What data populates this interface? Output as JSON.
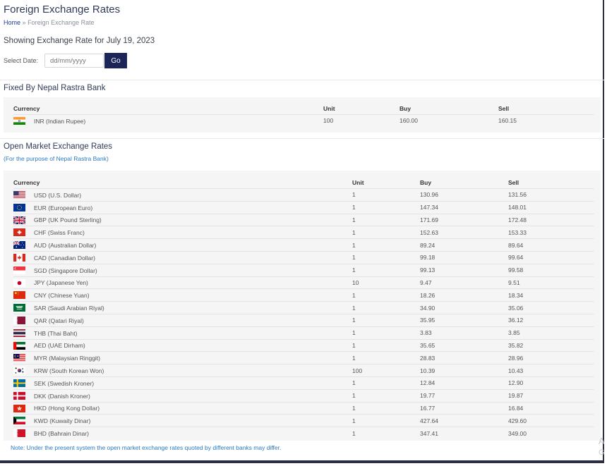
{
  "page": {
    "title": "Foreign Exchange Rates",
    "breadcrumb": {
      "home": "Home",
      "separator": "»",
      "current": "Foreign Exchange Rate"
    },
    "showing": "Showing Exchange Rate for July 19, 2023",
    "date_label": "Select Date:",
    "date_placeholder": "dd/mm/yyyy",
    "go_label": "Go"
  },
  "fixed": {
    "title": "Fixed By Nepal Rastra Bank",
    "headers": {
      "currency": "Currency",
      "unit": "Unit",
      "buy": "Buy",
      "sell": "Sell"
    },
    "rows": [
      {
        "flag": "india-flag-icon",
        "currency": "INR (Indian Rupee)",
        "unit": "100",
        "buy": "160.00",
        "sell": "160.15"
      }
    ]
  },
  "open_market": {
    "title": "Open Market Exchange Rates",
    "subtitle": "(For the purpose of Nepal Rastra Bank)",
    "headers": {
      "currency": "Currency",
      "unit": "Unit",
      "buy": "Buy",
      "sell": "Sell"
    },
    "rows": [
      {
        "flag": "usa-flag-icon",
        "currency": "USD (U.S. Dollar)",
        "unit": "1",
        "buy": "130.96",
        "sell": "131.56"
      },
      {
        "flag": "eu-flag-icon",
        "currency": "EUR (European Euro)",
        "unit": "1",
        "buy": "147.34",
        "sell": "148.01"
      },
      {
        "flag": "uk-flag-icon",
        "currency": "GBP (UK Pound Sterling)",
        "unit": "1",
        "buy": "171.69",
        "sell": "172.48"
      },
      {
        "flag": "switzerland-flag-icon",
        "currency": "CHF (Swiss Franc)",
        "unit": "1",
        "buy": "152.63",
        "sell": "153.33"
      },
      {
        "flag": "australia-flag-icon",
        "currency": "AUD (Australian Dollar)",
        "unit": "1",
        "buy": "89.24",
        "sell": "89.64"
      },
      {
        "flag": "canada-flag-icon",
        "currency": "CAD (Canadian Dollar)",
        "unit": "1",
        "buy": "99.18",
        "sell": "99.64"
      },
      {
        "flag": "singapore-flag-icon",
        "currency": "SGD (Singapore Dollar)",
        "unit": "1",
        "buy": "99.13",
        "sell": "99.58"
      },
      {
        "flag": "japan-flag-icon",
        "currency": "JPY (Japanese Yen)",
        "unit": "10",
        "buy": "9.47",
        "sell": "9.51"
      },
      {
        "flag": "china-flag-icon",
        "currency": "CNY (Chinese Yuan)",
        "unit": "1",
        "buy": "18.26",
        "sell": "18.34"
      },
      {
        "flag": "saudi-arabia-flag-icon",
        "currency": "SAR (Saudi Arabian Riyal)",
        "unit": "1",
        "buy": "34.90",
        "sell": "35.06"
      },
      {
        "flag": "qatar-flag-icon",
        "currency": "QAR (Qatari Riyal)",
        "unit": "1",
        "buy": "35.95",
        "sell": "36.12"
      },
      {
        "flag": "thailand-flag-icon",
        "currency": "THB (Thai Baht)",
        "unit": "1",
        "buy": "3.83",
        "sell": "3.85"
      },
      {
        "flag": "uae-flag-icon",
        "currency": "AED (UAE Dirham)",
        "unit": "1",
        "buy": "35.65",
        "sell": "35.82"
      },
      {
        "flag": "malaysia-flag-icon",
        "currency": "MYR (Malaysian Ringgit)",
        "unit": "1",
        "buy": "28.83",
        "sell": "28.96"
      },
      {
        "flag": "south-korea-flag-icon",
        "currency": "KRW (South Korean Won)",
        "unit": "100",
        "buy": "10.39",
        "sell": "10.43"
      },
      {
        "flag": "sweden-flag-icon",
        "currency": "SEK (Swedish Kroner)",
        "unit": "1",
        "buy": "12.84",
        "sell": "12.90"
      },
      {
        "flag": "denmark-flag-icon",
        "currency": "DKK (Danish Kroner)",
        "unit": "1",
        "buy": "19.77",
        "sell": "19.87"
      },
      {
        "flag": "hong-kong-flag-icon",
        "currency": "HKD (Hong Kong Dollar)",
        "unit": "1",
        "buy": "16.77",
        "sell": "16.84"
      },
      {
        "flag": "kuwait-flag-icon",
        "currency": "KWD (Kuwaity Dinar)",
        "unit": "1",
        "buy": "427.64",
        "sell": "429.60"
      },
      {
        "flag": "bahrain-flag-icon",
        "currency": "BHD (Bahrain Dinar)",
        "unit": "1",
        "buy": "347.41",
        "sell": "349.00"
      }
    ],
    "note": "Note: Under the present system the open market exchange rates quoted by different banks may differ."
  },
  "watermark": {
    "line1": "A",
    "line2": "G"
  },
  "colors": {
    "go_button": "#1c2558",
    "title": "#2f3a56",
    "link_blue": "#2a7abf",
    "panel": "#f5f5f6"
  }
}
